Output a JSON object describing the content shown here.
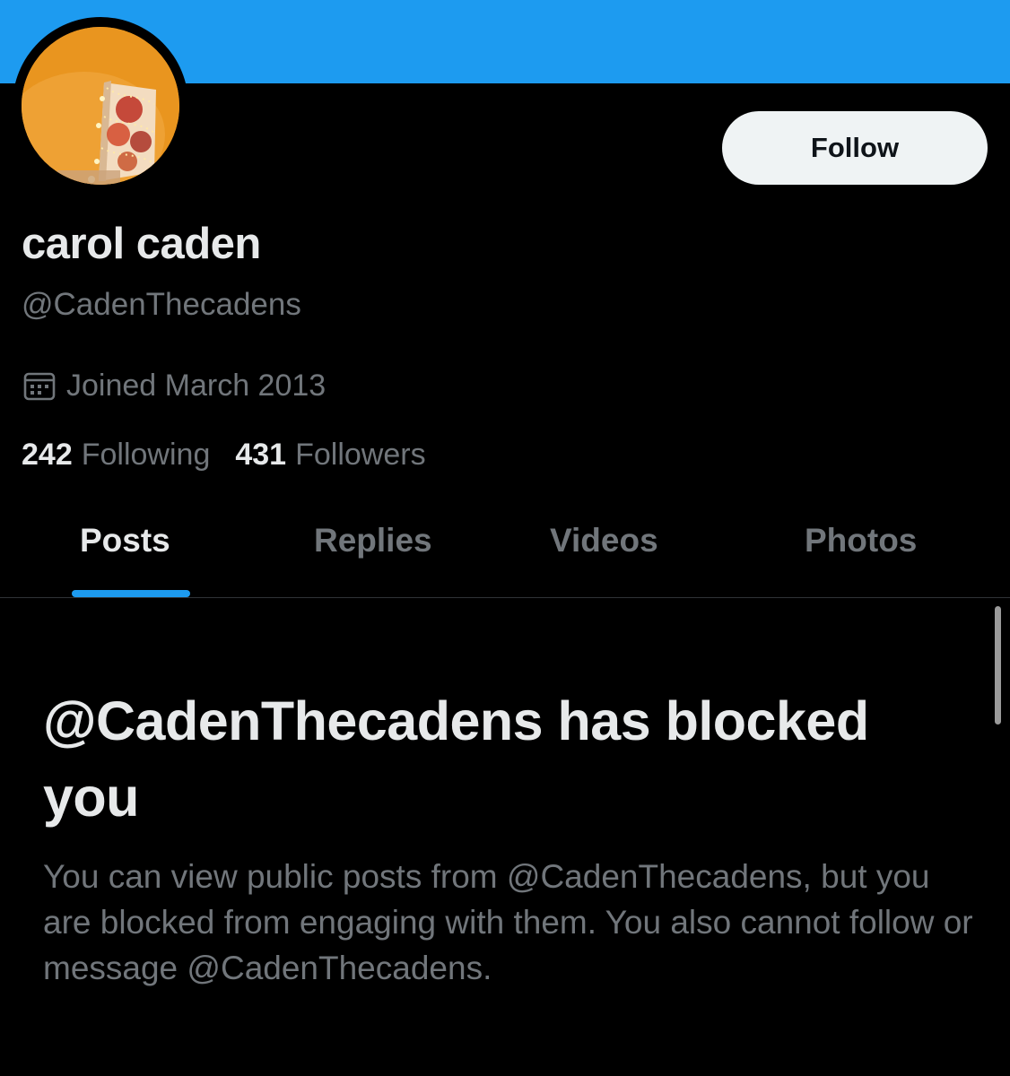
{
  "profile": {
    "display_name": "carol caden",
    "handle": "@CadenThecadens",
    "joined": "Joined March 2013",
    "following_count": "242",
    "following_label": "Following",
    "followers_count": "431",
    "followers_label": "Followers",
    "follow_label": "Follow",
    "banner_color": "#1d9bf0"
  },
  "tabs": [
    {
      "label": "Posts",
      "active": true
    },
    {
      "label": "Replies",
      "active": false
    },
    {
      "label": "Videos",
      "active": false
    },
    {
      "label": "Photos",
      "active": false
    }
  ],
  "blocked": {
    "title": "@CadenThecadens has blocked you",
    "message": "You can view public posts from @CadenThecadens, but you are blocked from engaging with them. You also cannot follow or message @CadenThecadens."
  },
  "icons": {
    "calendar": "calendar-icon"
  },
  "colors": {
    "accent": "#1d9bf0",
    "text_primary": "#e7e9ea",
    "text_secondary": "#71767b",
    "background": "#000000"
  }
}
